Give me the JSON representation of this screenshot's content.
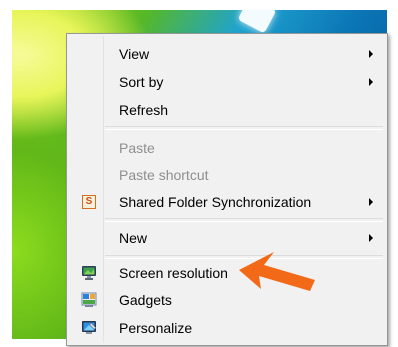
{
  "context_menu": {
    "items": [
      {
        "label": "View",
        "enabled": true,
        "submenu": true
      },
      {
        "label": "Sort by",
        "enabled": true,
        "submenu": true
      },
      {
        "label": "Refresh",
        "enabled": true,
        "submenu": false
      },
      {
        "label": "Paste",
        "enabled": false,
        "submenu": false
      },
      {
        "label": "Paste shortcut",
        "enabled": false,
        "submenu": false
      },
      {
        "label": "Shared Folder Synchronization",
        "enabled": true,
        "submenu": true,
        "icon": "shared-folder-sync-icon",
        "icon_glyph": "S"
      },
      {
        "label": "New",
        "enabled": true,
        "submenu": true
      },
      {
        "label": "Screen resolution",
        "enabled": true,
        "submenu": false,
        "icon": "screen-resolution-icon",
        "highlighted_by_arrow": true
      },
      {
        "label": "Gadgets",
        "enabled": true,
        "submenu": false,
        "icon": "gadgets-icon"
      },
      {
        "label": "Personalize",
        "enabled": true,
        "submenu": false,
        "icon": "personalize-icon"
      }
    ]
  },
  "annotation": {
    "icon": "orange-arrow-icon",
    "color": "#f26a17"
  }
}
